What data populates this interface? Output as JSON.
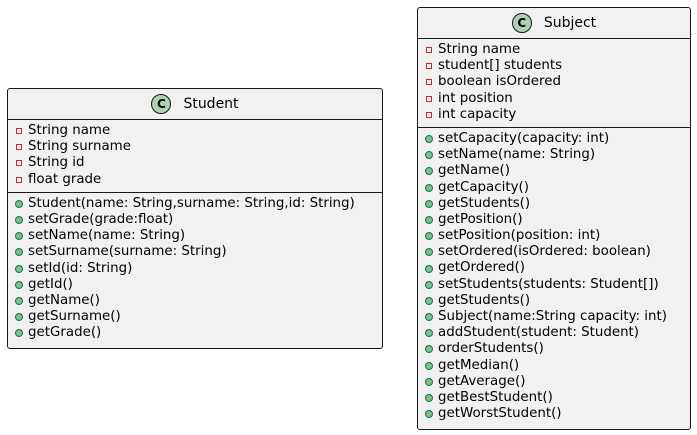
{
  "classes": {
    "student": {
      "badge": "C",
      "name": "Student",
      "attributes": [
        "String name",
        "String surname",
        "String id",
        "float grade"
      ],
      "methods": [
        "Student(name: String,surname: String,id: String)",
        "setGrade(grade:float)",
        "setName(name: String)",
        "setSurname(surname: String)",
        "setId(id: String)",
        "getId()",
        "getName()",
        "getSurname()",
        "getGrade()"
      ]
    },
    "subject": {
      "badge": "C",
      "name": "Subject",
      "attributes": [
        "String name",
        "student[] students",
        "boolean isOrdered",
        "int position",
        "int capacity"
      ],
      "methods": [
        "setCapacity(capacity: int)",
        "setName(name: String)",
        "getName()",
        "getCapacity()",
        "getStudents()",
        "getPosition()",
        "setPosition(position: int)",
        "setOrdered(isOrdered: boolean)",
        "getOrdered()",
        "setStudents(students: Student[])",
        "getStudents()",
        "Subject(name:String capacity: int)",
        "addStudent(student: Student)",
        "orderStudents()",
        "getMedian()",
        "getAverage()",
        "getBestStudent()",
        "getWorstStudent()"
      ]
    }
  },
  "colors": {
    "box_fill": "#f1f1f1",
    "border": "#181818",
    "badge_fill": "#add1b2",
    "private_marker": "#c82930",
    "public_fill": "#84be84",
    "public_border": "#038048"
  }
}
